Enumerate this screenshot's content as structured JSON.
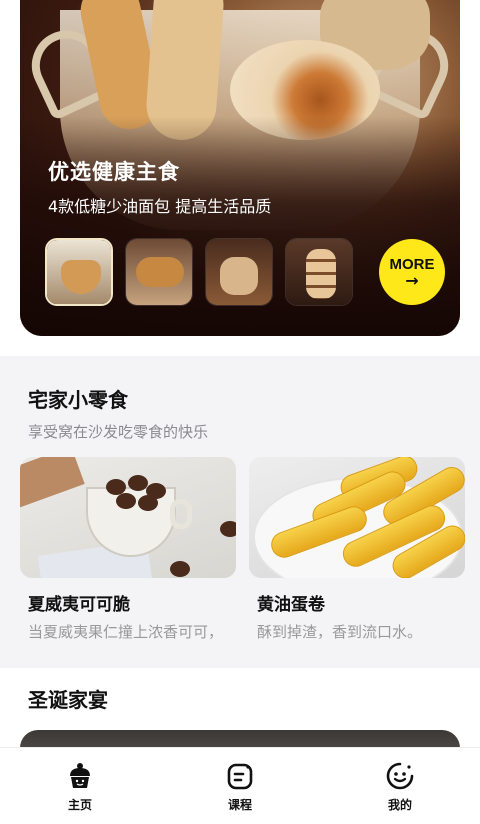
{
  "hero": {
    "title": "优选健康主食",
    "subtitle": "4款低糖少油面包 提高生活品质",
    "more_label": "MORE",
    "more_arrow": "→",
    "thumb_count": 4,
    "accent_color": "#ffe81a"
  },
  "snacks": {
    "title": "宅家小零食",
    "subtitle": "享受窝在沙发吃零食的快乐",
    "cards": [
      {
        "title": "夏威夷可可脆",
        "desc": "当夏威夷果仁撞上浓香可可，"
      },
      {
        "title": "黄油蛋卷",
        "desc": "酥到掉渣，香到流口水。"
      }
    ]
  },
  "christmas": {
    "title": "圣诞家宴"
  },
  "bottom_nav": {
    "items": [
      {
        "label": "主页",
        "icon": "cupcake-icon"
      },
      {
        "label": "课程",
        "icon": "notepad-icon"
      },
      {
        "label": "我的",
        "icon": "smiley-icon"
      }
    ]
  }
}
